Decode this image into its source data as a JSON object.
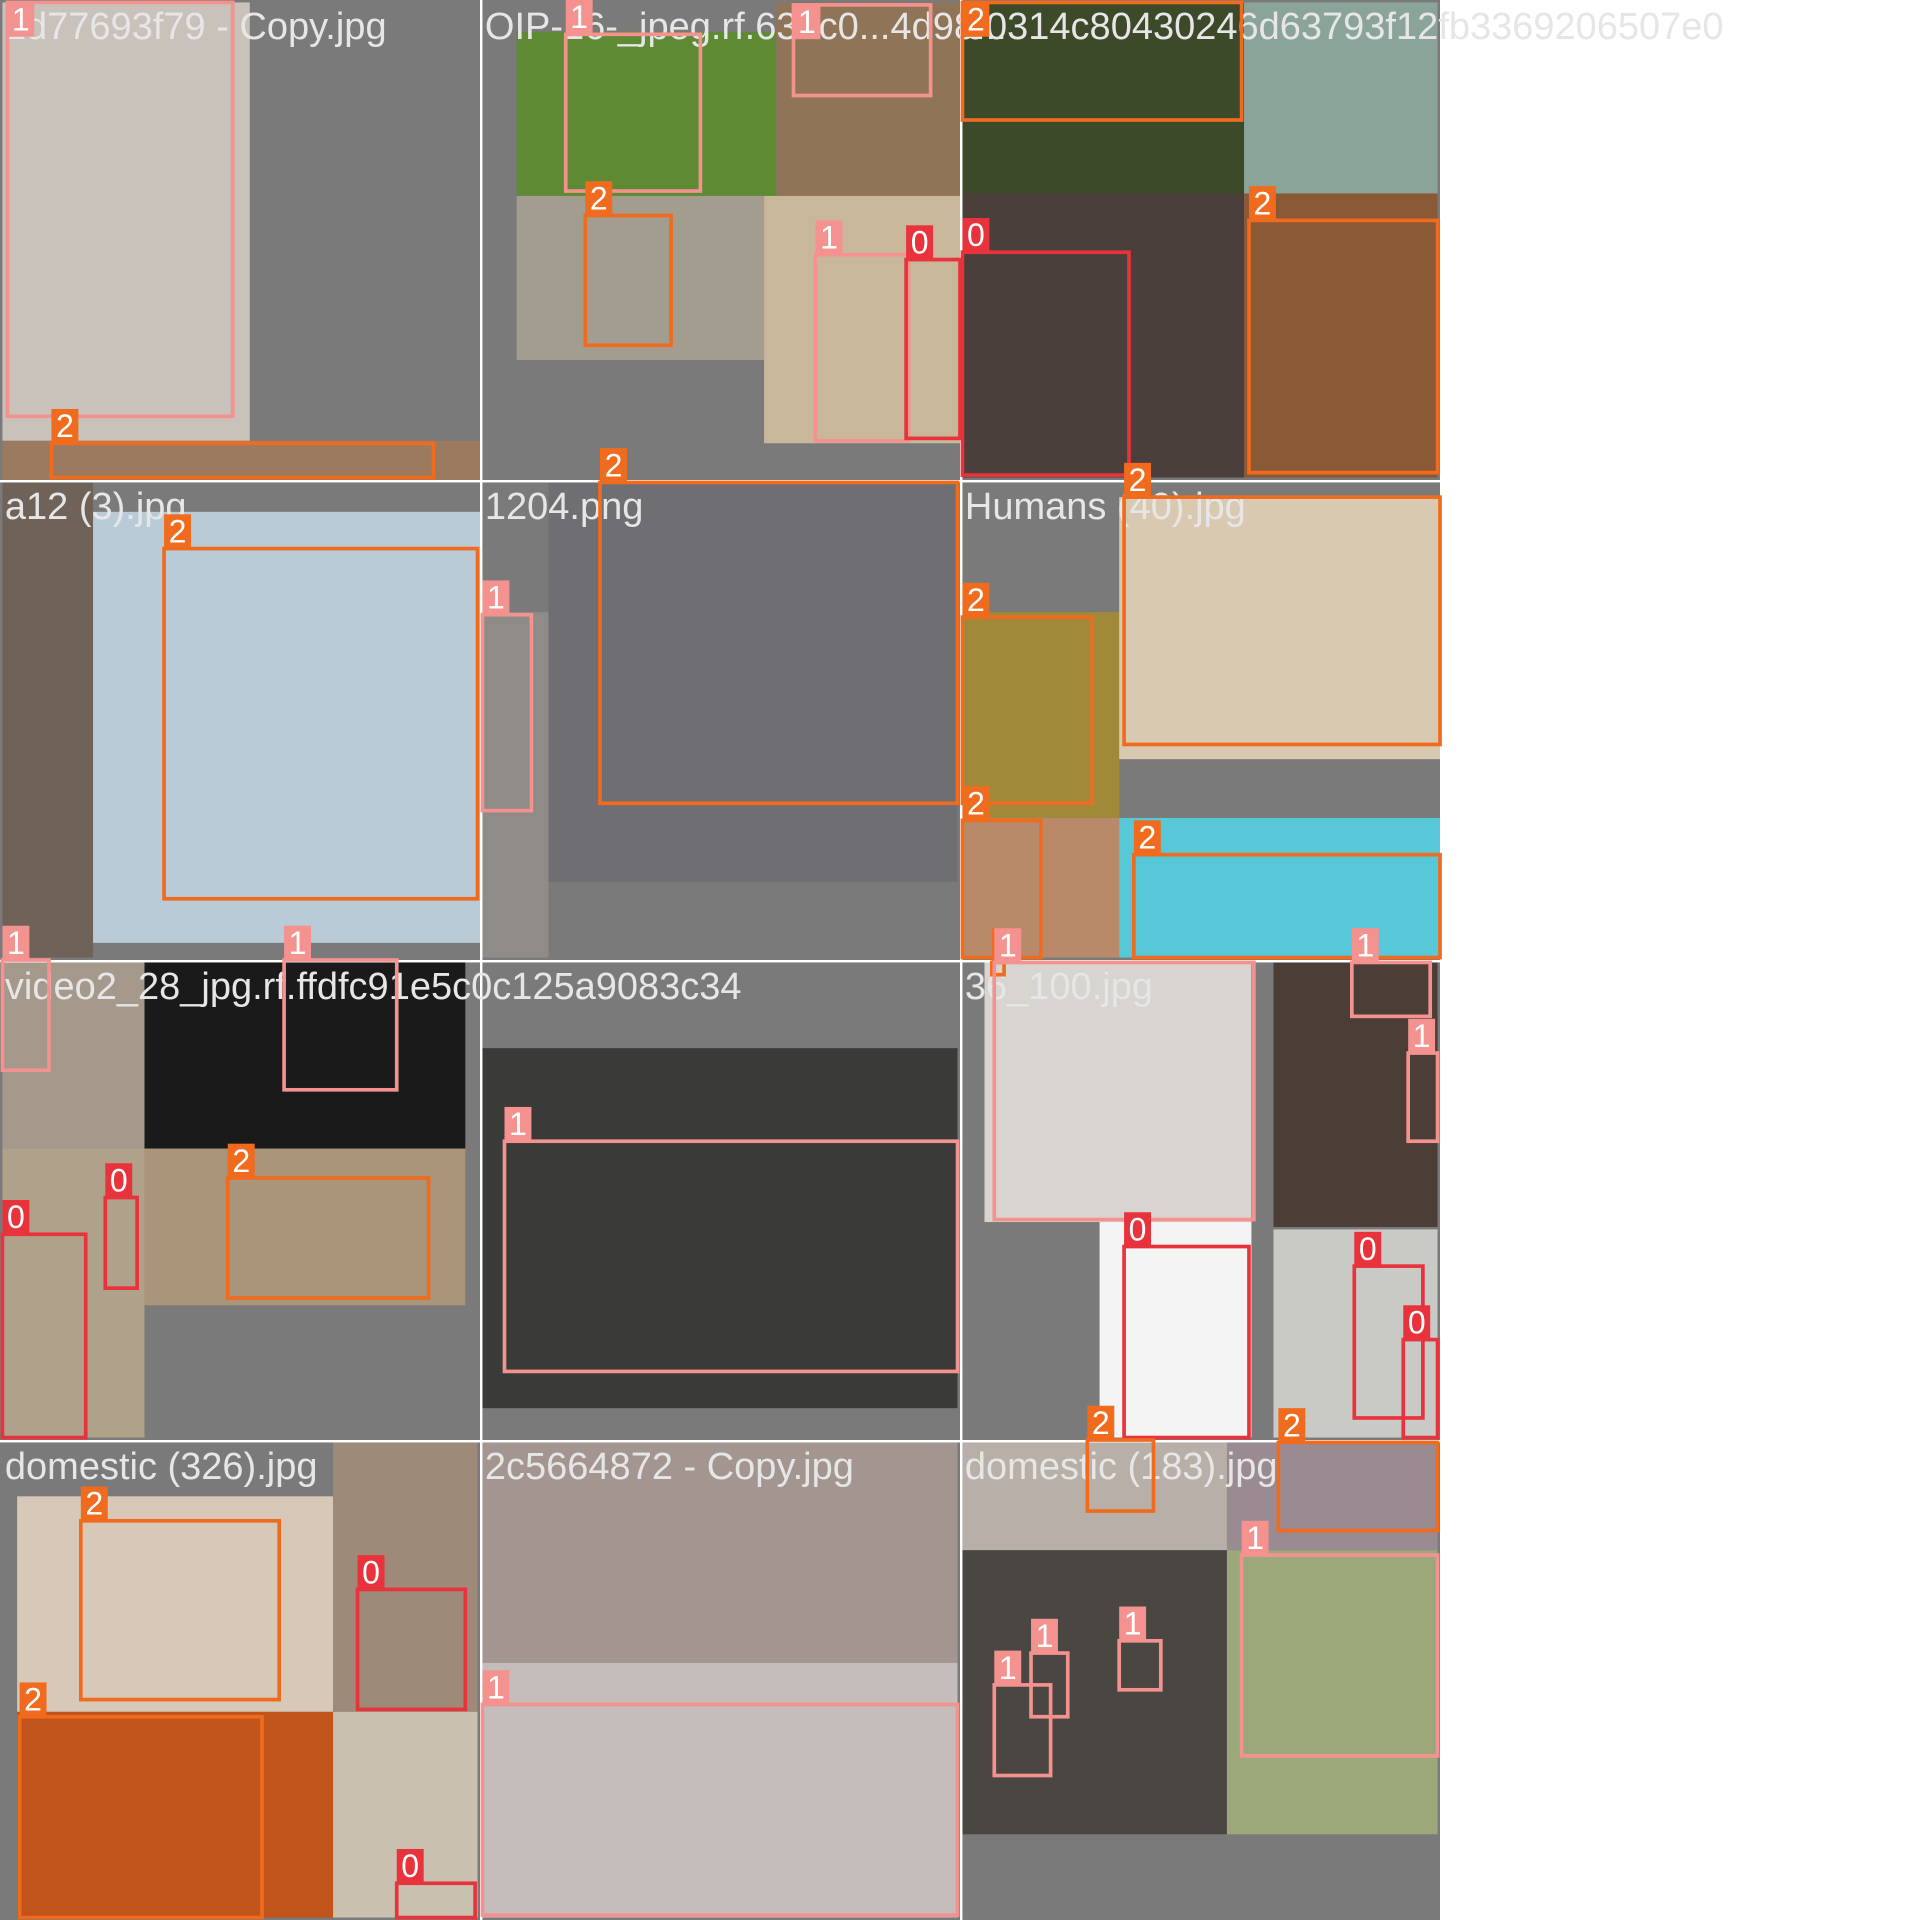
{
  "class_colors": {
    "0": "#e8333c",
    "1": "#f4928f",
    "2": "#f06b1d"
  },
  "grid_background": "#7a7a7a",
  "cells": [
    {
      "title": "1d77693f79 - Copy.jpg",
      "boxes": [
        {
          "cls": "1"
        },
        {
          "cls": "2"
        }
      ]
    },
    {
      "title": "OIP-16-_jpeg.rf.631c0...4d98...",
      "boxes": [
        {
          "cls": "1"
        },
        {
          "cls": "1"
        },
        {
          "cls": "2"
        },
        {
          "cls": "1"
        },
        {
          "cls": "0"
        }
      ]
    },
    {
      "title": "00314c80430246d63793f12fb3369206507e0",
      "boxes": [
        {
          "cls": "2"
        },
        {
          "cls": "0"
        },
        {
          "cls": "2"
        }
      ]
    },
    {
      "title": "a12 (3).jpg",
      "boxes": [
        {
          "cls": "2"
        },
        {
          "cls": "1"
        }
      ]
    },
    {
      "title": "1204.png",
      "boxes": [
        {
          "cls": "2"
        }
      ]
    },
    {
      "title": "Humans (40).jpg",
      "boxes": [
        {
          "cls": "2"
        },
        {
          "cls": "2"
        },
        {
          "cls": "2"
        },
        {
          "cls": "2"
        },
        {
          "cls": "2"
        }
      ]
    },
    {
      "title": "video2_28_jpg.rf.ffdfc91e5c0c125a9083c34",
      "boxes": [
        {
          "cls": "1"
        },
        {
          "cls": "1"
        },
        {
          "cls": "0"
        },
        {
          "cls": "0"
        },
        {
          "cls": "2"
        }
      ]
    },
    {
      "title": "",
      "boxes": [
        {
          "cls": "1"
        }
      ]
    },
    {
      "title": "36_100.jpg",
      "boxes": [
        {
          "cls": "1"
        },
        {
          "cls": "1"
        },
        {
          "cls": "1"
        },
        {
          "cls": "0"
        },
        {
          "cls": "0"
        },
        {
          "cls": "0"
        }
      ]
    },
    {
      "title": "domestic (326).jpg",
      "boxes": [
        {
          "cls": "2"
        },
        {
          "cls": "0"
        },
        {
          "cls": "2"
        },
        {
          "cls": "0"
        }
      ]
    },
    {
      "title": "2c5664872 - Copy.jpg",
      "boxes": [
        {
          "cls": "1"
        }
      ]
    },
    {
      "title": "domestic (183).jpg",
      "boxes": [
        {
          "cls": "2"
        },
        {
          "cls": "2"
        },
        {
          "cls": "1"
        },
        {
          "cls": "1"
        },
        {
          "cls": "1"
        },
        {
          "cls": "1"
        }
      ]
    }
  ]
}
